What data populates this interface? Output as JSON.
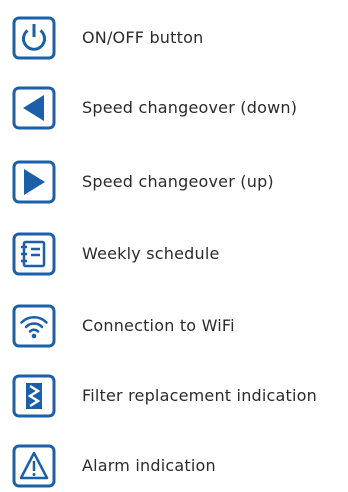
{
  "colors": {
    "accent": "#1b5fa8",
    "text": "#2b2b2b"
  },
  "items": [
    {
      "icon": "power-icon",
      "label": "ON/OFF button"
    },
    {
      "icon": "arrow-left-icon",
      "label": "Speed changeover (down)"
    },
    {
      "icon": "arrow-right-icon",
      "label": "Speed changeover (up)"
    },
    {
      "icon": "calendar-schedule-icon",
      "label": "Weekly schedule"
    },
    {
      "icon": "wifi-icon",
      "label": "Connection to WiFi"
    },
    {
      "icon": "filter-icon",
      "label": "Filter replacement indication"
    },
    {
      "icon": "alarm-warning-icon",
      "label": "Alarm indication"
    }
  ]
}
